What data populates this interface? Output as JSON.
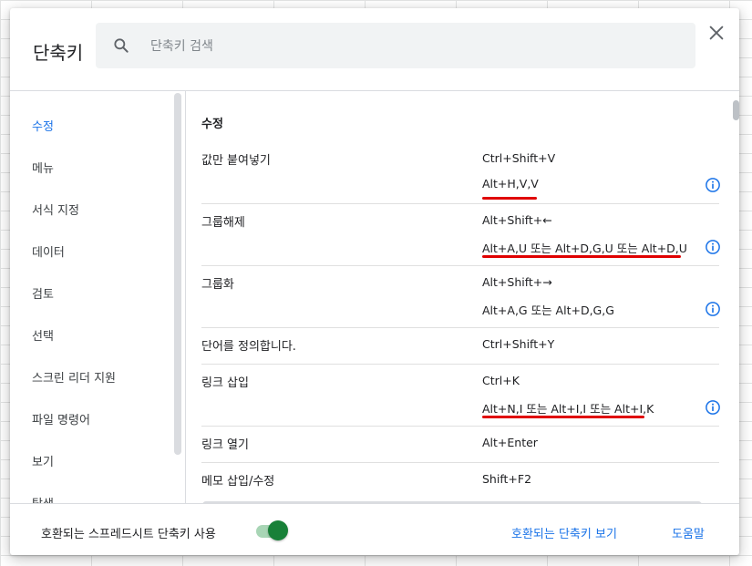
{
  "dialog": {
    "title": "단축키",
    "search_placeholder": "단축키 검색"
  },
  "sidebar": {
    "items": [
      {
        "label": "수정",
        "active": true
      },
      {
        "label": "메뉴"
      },
      {
        "label": "서식 지정"
      },
      {
        "label": "데이터"
      },
      {
        "label": "검토"
      },
      {
        "label": "선택"
      },
      {
        "label": "스크린 리더 지원"
      },
      {
        "label": "파일 명령어"
      },
      {
        "label": "보기"
      },
      {
        "label": "탐색"
      }
    ]
  },
  "content": {
    "section_title": "수정",
    "rows": [
      {
        "action": "값만 붙여넣기",
        "keys": [
          "Ctrl+Shift+V",
          "Alt+H,V,V"
        ]
      },
      {
        "action": "그룹해제",
        "keys": [
          "Alt+Shift+←",
          "Alt+A,U 또는 Alt+D,G,U 또는 Alt+D,U"
        ]
      },
      {
        "action": "그룹화",
        "keys": [
          "Alt+Shift+→",
          "Alt+A,G 또는 Alt+D,G,G"
        ]
      },
      {
        "action": "단어를 정의합니다.",
        "keys": [
          "Ctrl+Shift+Y"
        ]
      },
      {
        "action": "링크 삽입",
        "keys": [
          "Ctrl+K",
          "Alt+N,I 또는 Alt+I,I 또는 Alt+I,K"
        ]
      },
      {
        "action": "링크 열기",
        "keys": [
          "Alt+Enter"
        ]
      },
      {
        "action": "메모 삽입/수정",
        "keys": [
          "Shift+F2"
        ]
      }
    ]
  },
  "footer": {
    "compat_label": "호환되는 스프레드시트 단축키 사용",
    "compat_enabled": true,
    "view_compat_link": "호환되는 단축키 보기",
    "help_link": "도움말"
  },
  "colors": {
    "accent": "#1a73e8",
    "toggle_on": "#188038",
    "annotation": "#e00000"
  }
}
